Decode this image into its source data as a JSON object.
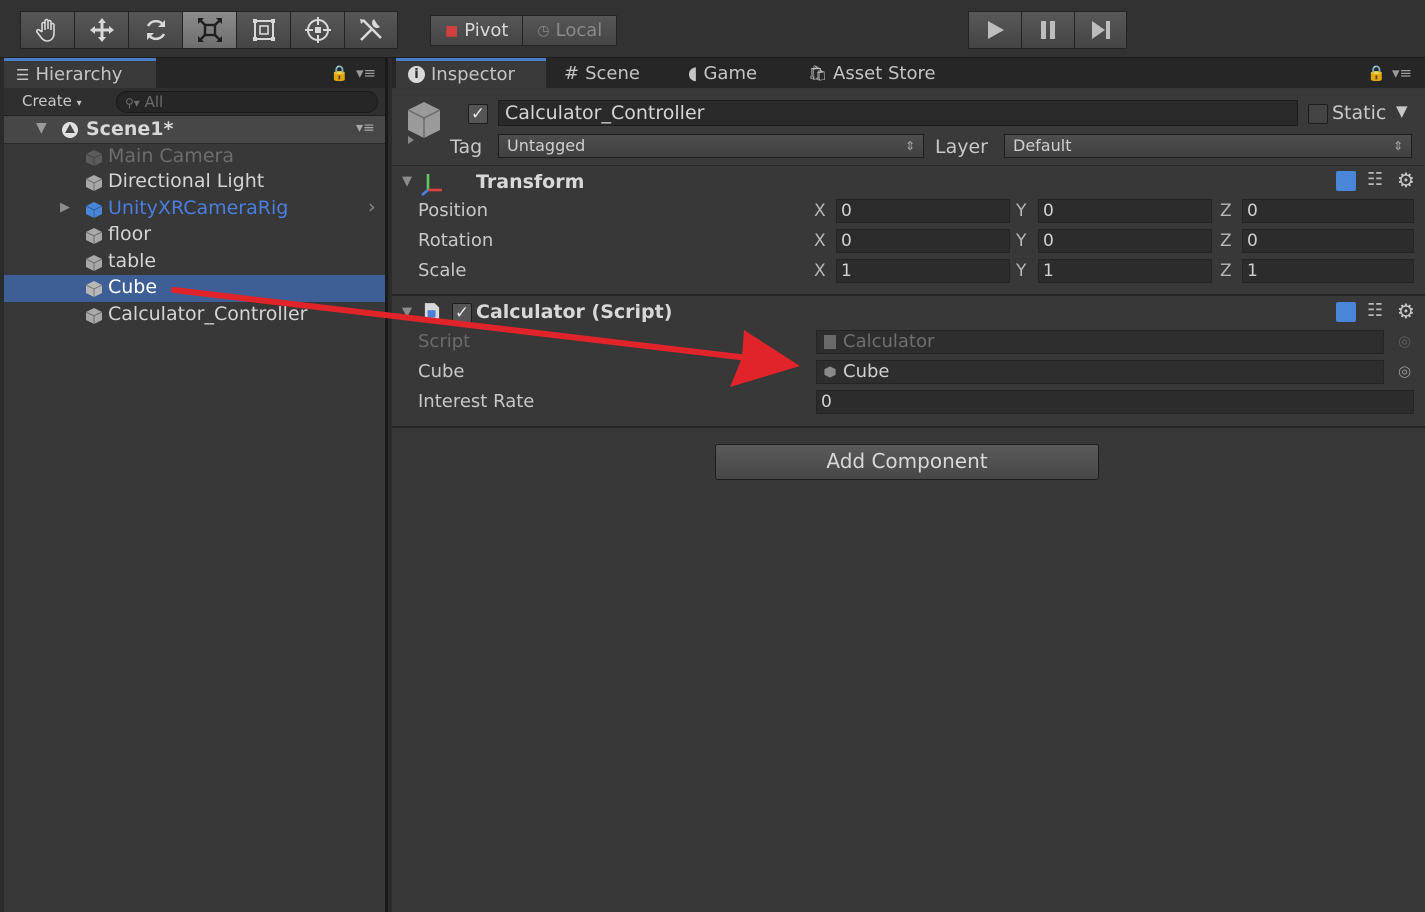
{
  "toolbar": {
    "tools": [
      "hand-tool",
      "move-tool",
      "rotate-tool",
      "scale-tool",
      "rect-tool",
      "transform-tool",
      "custom-tool"
    ],
    "active_tool": "scale-tool",
    "pivot_label": "Pivot",
    "local_label": "Local"
  },
  "hierarchy": {
    "tab_label": "Hierarchy",
    "create_label": "Create",
    "search_placeholder": "All",
    "scene_name": "Scene1*",
    "items": [
      {
        "label": "Main Camera"
      },
      {
        "label": "Directional Light"
      },
      {
        "label": "UnityXRCameraRig"
      },
      {
        "label": "floor"
      },
      {
        "label": "table"
      },
      {
        "label": "Cube"
      },
      {
        "label": "Calculator_Controller"
      }
    ]
  },
  "inspector": {
    "tabs": {
      "inspector": "Inspector",
      "scene": "Scene",
      "game": "Game",
      "asset_store": "Asset Store"
    },
    "object_name": "Calculator_Controller",
    "static_label": "Static",
    "tag_label": "Tag",
    "tag_value": "Untagged",
    "layer_label": "Layer",
    "layer_value": "Default",
    "transform": {
      "title": "Transform",
      "rows": [
        {
          "label": "Position",
          "x": "0",
          "y": "0",
          "z": "0"
        },
        {
          "label": "Rotation",
          "x": "0",
          "y": "0",
          "z": "0"
        },
        {
          "label": "Scale",
          "x": "1",
          "y": "1",
          "z": "1"
        }
      ],
      "axis_x": "X",
      "axis_y": "Y",
      "axis_z": "Z"
    },
    "script_component": {
      "title": "Calculator (Script)",
      "script_label": "Script",
      "script_value": "Calculator",
      "cube_label": "Cube",
      "cube_value": "Cube",
      "interest_label": "Interest Rate",
      "interest_value": "0"
    },
    "add_component_label": "Add Component"
  },
  "colors": {
    "accent_arrow": "#e0242a",
    "selection": "#3e5f96",
    "prefab_blue": "#4a7ee0"
  }
}
